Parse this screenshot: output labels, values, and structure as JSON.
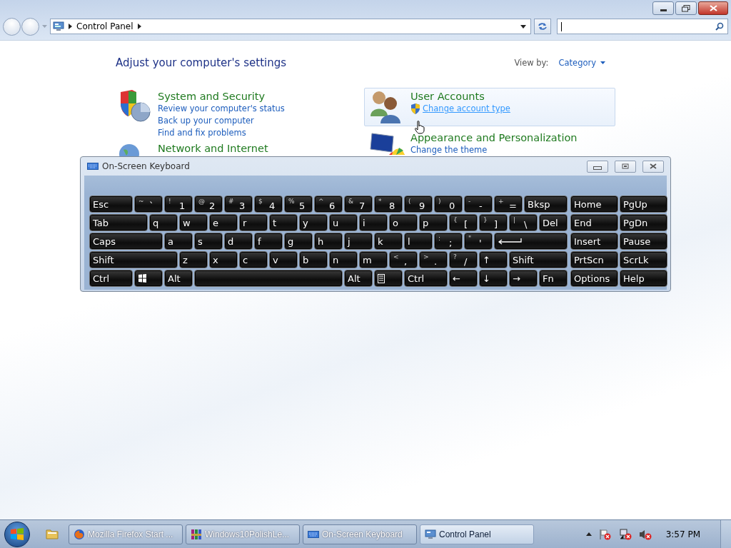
{
  "address": {
    "crumbs": [
      "Control Panel"
    ]
  },
  "heading": "Adjust your computer's settings",
  "view_by": {
    "label": "View by:",
    "value": "Category"
  },
  "columns": [
    [
      {
        "kind": "security",
        "title": "System and Security",
        "highlighted": false,
        "links": [
          {
            "label": "Review your computer's status",
            "shield": false,
            "hovered": false
          },
          {
            "label": "Back up your computer",
            "shield": false,
            "hovered": false
          },
          {
            "label": "Find and fix problems",
            "shield": false,
            "hovered": false
          }
        ]
      },
      {
        "kind": "network",
        "title": "Network and Internet",
        "highlighted": false
      }
    ],
    [
      {
        "kind": "users",
        "title": "User Accounts",
        "highlighted": true,
        "links": [
          {
            "label": "Change account type",
            "shield": true,
            "hovered": true
          }
        ]
      },
      {
        "kind": "appearance",
        "title": "Appearance and Personalization",
        "highlighted": false,
        "links": [
          {
            "label": "Change the theme",
            "shield": false,
            "hovered": false
          }
        ]
      }
    ]
  ],
  "keyboard": {
    "title": "On-Screen Keyboard",
    "main_rows": [
      [
        {
          "label": "Esc"
        },
        {
          "shift": "~",
          "label": "`"
        },
        {
          "shift": "!",
          "label": "1"
        },
        {
          "shift": "@",
          "label": "2"
        },
        {
          "shift": "#",
          "label": "3"
        },
        {
          "shift": "$",
          "label": "4"
        },
        {
          "shift": "%",
          "label": "5"
        },
        {
          "shift": "^",
          "label": "6"
        },
        {
          "shift": "&",
          "label": "7"
        },
        {
          "shift": "*",
          "label": "8"
        },
        {
          "shift": "(",
          "label": "9"
        },
        {
          "shift": ")",
          "label": "0"
        },
        {
          "shift": "-",
          "label": "-"
        },
        {
          "shift": "+",
          "label": "="
        },
        {
          "label": "Bksp"
        }
      ],
      [
        {
          "label": "Tab"
        },
        {
          "label": "q"
        },
        {
          "label": "w"
        },
        {
          "label": "e"
        },
        {
          "label": "r"
        },
        {
          "label": "t"
        },
        {
          "label": "y"
        },
        {
          "label": "u"
        },
        {
          "label": "i"
        },
        {
          "label": "o"
        },
        {
          "label": "p"
        },
        {
          "shift": "{",
          "label": "["
        },
        {
          "shift": "}",
          "label": "]"
        },
        {
          "shift": "|",
          "label": "\\"
        },
        {
          "label": "Del"
        }
      ],
      [
        {
          "label": "Caps"
        },
        {
          "label": "a"
        },
        {
          "label": "s"
        },
        {
          "label": "d"
        },
        {
          "label": "f"
        },
        {
          "label": "g"
        },
        {
          "label": "h"
        },
        {
          "label": "j"
        },
        {
          "label": "k"
        },
        {
          "label": "l"
        },
        {
          "shift": ":",
          "label": ";"
        },
        {
          "shift": "\"",
          "label": "'"
        },
        {
          "kind": "enter"
        }
      ],
      [
        {
          "label": "Shift"
        },
        {
          "label": "z"
        },
        {
          "label": "x"
        },
        {
          "label": "c"
        },
        {
          "label": "v"
        },
        {
          "label": "b"
        },
        {
          "label": "n"
        },
        {
          "label": "m"
        },
        {
          "shift": "<",
          "label": ","
        },
        {
          "shift": ">",
          "label": "."
        },
        {
          "shift": "?",
          "label": "/"
        },
        {
          "label": "↑"
        },
        {
          "label": "Shift"
        }
      ],
      [
        {
          "label": "Ctrl"
        },
        {
          "kind": "windows"
        },
        {
          "label": "Alt"
        },
        {
          "kind": "space"
        },
        {
          "label": "Alt"
        },
        {
          "kind": "menu"
        },
        {
          "label": "Ctrl"
        },
        {
          "label": "←"
        },
        {
          "label": "↓"
        },
        {
          "label": "→"
        },
        {
          "label": "Fn"
        }
      ]
    ],
    "side_rows": [
      [
        {
          "label": "Home"
        },
        {
          "label": "PgUp"
        }
      ],
      [
        {
          "label": "End"
        },
        {
          "label": "PgDn"
        }
      ],
      [
        {
          "label": "Insert"
        },
        {
          "label": "Pause"
        }
      ],
      [
        {
          "label": "PrtScn"
        },
        {
          "label": "ScrLk"
        }
      ],
      [
        {
          "label": "Options"
        },
        {
          "label": "Help"
        }
      ]
    ]
  },
  "taskbar": {
    "buttons": [
      {
        "kind": "firefox",
        "label": "Mozilla Firefox Start ...",
        "selected": false
      },
      {
        "kind": "archive",
        "label": "Windows10PolishLe...",
        "selected": false
      },
      {
        "kind": "keyboard",
        "label": "On-Screen Keyboard",
        "selected": false
      },
      {
        "kind": "control-panel",
        "label": "Control Panel",
        "selected": true
      }
    ],
    "clock": "3:57 PM"
  }
}
